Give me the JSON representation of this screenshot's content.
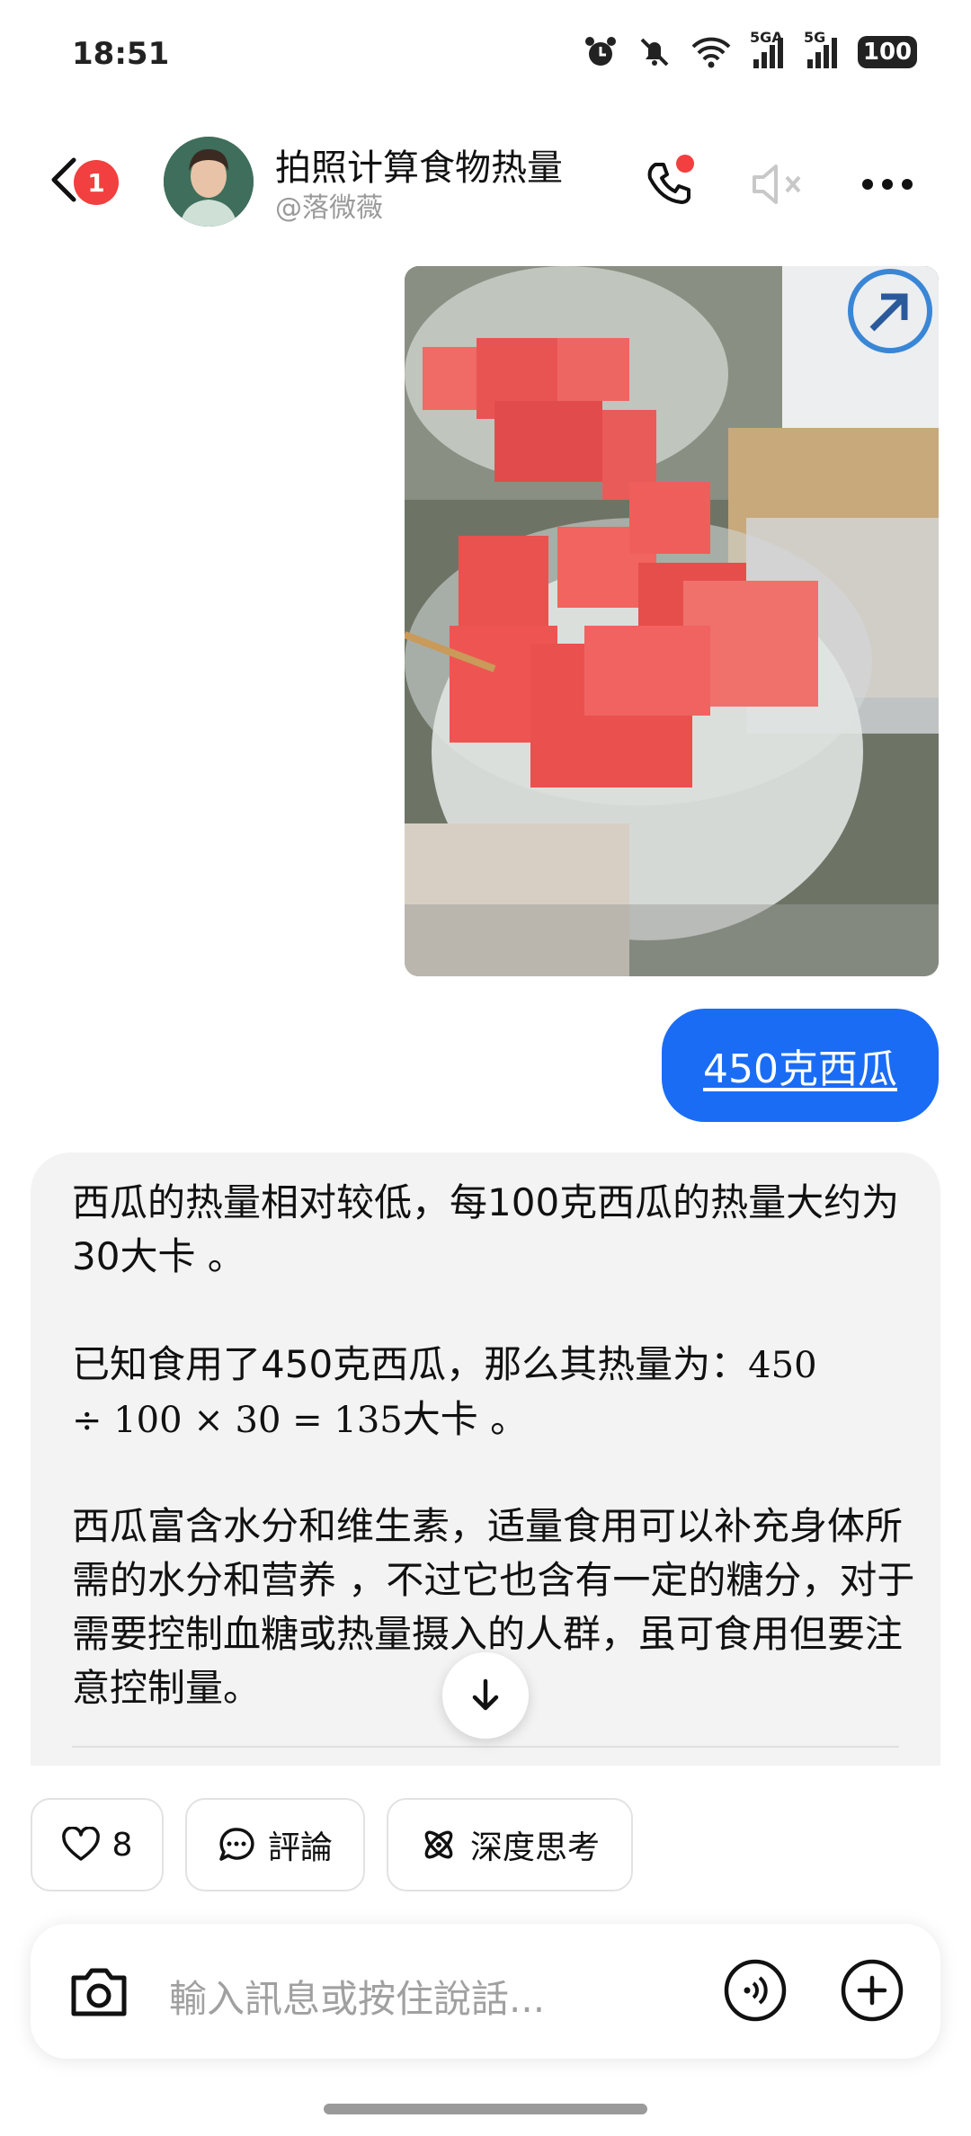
{
  "status_bar": {
    "time": "18:51",
    "battery": "100",
    "signal_1": "5GA",
    "signal_2": "5G"
  },
  "header": {
    "unread_count": "1",
    "title": "拍照计算食物热量",
    "handle": "@落微薇"
  },
  "messages": {
    "user_text": "450克西瓜",
    "reply": {
      "p1": "西瓜的热量相对较低，每100克西瓜的热量大约为30大卡 。",
      "p2_prefix": "已知食用了450克西瓜，那么其热量为：",
      "p2_math_a": "450",
      "p2_math_b": "÷ 100 × 30 = 135",
      "p2_suffix": "大卡 。",
      "p3": "西瓜富含水分和维生素，适量食用可以补充身体所需的水分和营养 ，不过它也含有一定的糖分，对于需要控制血糖或热量摄入的人群，虽可食用但要注意控制量。"
    }
  },
  "actions": {
    "like_count": "8",
    "comment_label": "評論",
    "deep_think_label": "深度思考"
  },
  "composer": {
    "placeholder": "輸入訊息或按住說話..."
  },
  "colors": {
    "accent": "#1a6cf5",
    "badge": "#f23f3f",
    "reply_bg": "#f3f3f3"
  }
}
